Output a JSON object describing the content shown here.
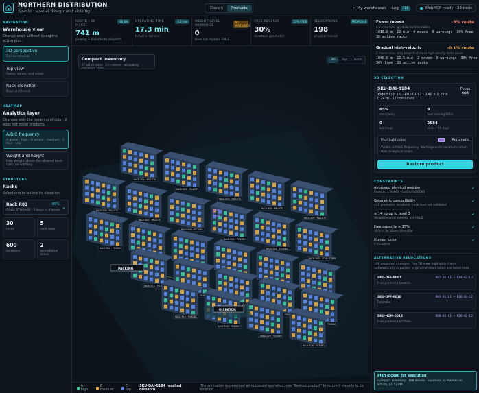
{
  "header": {
    "title": "NORTHERN DISTRIBUTION",
    "subtitle": "Spacio · spatial design and slotting",
    "modes": [
      "Design",
      "Products"
    ],
    "active_mode": "Products",
    "my_warehouses": "← My warehouses",
    "log_label": "Log",
    "log_count": "186",
    "webmcp": "WebMCP ready · 33 tools"
  },
  "left": {
    "nav_label": "NAVIGATION",
    "view_title": "Warehouse view",
    "view_desc": "Change scale without losing the active plan.",
    "views": [
      {
        "title": "3D perspective",
        "sub": "Full warehouse",
        "active": true
      },
      {
        "title": "Top view",
        "sub": "Racks, zones, and aisles",
        "active": false
      },
      {
        "title": "Rack elevation",
        "sub": "Bays and levels",
        "active": false
      }
    ],
    "heatmap_label": "HEATMAP",
    "heatmap_title": "Analytics layer",
    "heatmap_desc": "Changes only the meaning of color; it does not move products.",
    "layers": [
      {
        "title": "A/B/C frequency",
        "sub": "A green · high · B amber · medium · C blue · low",
        "active": true
      },
      {
        "title": "Weight and height",
        "sub": "Red: weight above the allowed level · dark: no warning",
        "active": false
      }
    ],
    "structure_label": "STRUCTURE",
    "structure_title": "Racks",
    "structure_desc": "Select one to isolate its elevation.",
    "rack": {
      "name": "Rack R03",
      "pct": "85%",
      "meta": "COLD STORAGE · 5 bays × 4 levels"
    },
    "stats": [
      {
        "value": "30",
        "label": "racks"
      },
      {
        "value": "5",
        "label": "rack rows"
      },
      {
        "value": "600",
        "label": "locations"
      },
      {
        "value": "2",
        "label": "operational zones"
      }
    ]
  },
  "kpis": [
    {
      "label": "ROUTE / 20 PICKS",
      "badge": "-16.6%",
      "value": "741 m",
      "sub": "picking + transfer to dispatch",
      "warn": false
    },
    {
      "label": "OPERATING TIME",
      "badge": "-3.2 min",
      "value": "17.3 min",
      "sub": "travel + service",
      "warn": false
    },
    {
      "label": "WEIGHT/LEVEL WARNINGS",
      "badge": "NO WARNINGS",
      "value": "0",
      "sub": "does not replace RNLE",
      "warn": true
    },
    {
      "label": "FREE RESERVE",
      "badge": "15% FREE",
      "value": "30%",
      "sub": "locations geometric",
      "warn": false
    },
    {
      "label": "RELOCATIONS",
      "badge": "PROPOSAL",
      "value": "198",
      "sub": "physical moves",
      "warn": false
    }
  ],
  "canvas": {
    "view_title": "Compact inventory",
    "view_sub": "27 active racks · 3 in reserve · occupancy maximum 100%",
    "view_buttons": [
      "3D",
      "Top",
      "Rack"
    ],
    "active_view_button": "3D",
    "floor_labels": [
      "PACKING",
      "DISPATCH"
    ],
    "rack_tags": [
      "RACK 801 · PALLETS",
      "RACK 802 · PALLETS",
      "RACK 803 · PALLETS",
      "RACK 804 · PALLETS",
      "RACK 805 · PALLETS",
      "RACK 806 · PALLETS",
      "RACK 807 · PALLETS",
      "RACK 808 · PICKING",
      "RACK R01 · PICKING",
      "RACK R02 · PICKING",
      "RACK R03 · COLD STORE",
      "RACK R04 · PICKING",
      "RACK R05 · PICKING",
      "RACK R06 · PICKING",
      "RACK R09 · PICKING",
      "RACK R10 · PICKING",
      "RACK R11 · PICKING",
      "RACK R12 · PICKING",
      "RACK R13 · PICKING",
      "RACK R14 · PICKING",
      "RACK R15 · PICKING",
      "RACK R16 · PICKING",
      "RACK R18 · PICKING",
      "RACK R20 · PICKING",
      "RACK R24 · PICKING",
      "RACK R26 · PICKING"
    ],
    "legend": [
      {
        "label": "A · high",
        "color": "#37d3a0"
      },
      {
        "label": "B · medium",
        "color": "#f2b13d"
      },
      {
        "label": "C · low",
        "color": "#5b8cf0"
      }
    ],
    "dispatch_msg": "SKU-DAI-0184 reached dispatch.",
    "legend_note": "The animation represented an outbound operation; use \"Restore product\" to return it visually to its location."
  },
  "right": {
    "scenarios": [
      {
        "title": "Fewer moves",
        "pct": "-3% route",
        "desc": "4 moves max · gradual implementation",
        "stats": "1018.8 m  22 min  4 moves  0 warnings  30% free\n30 active racks"
      },
      {
        "title": "Gradual high-velocity",
        "pct": "-0.1% route",
        "desc": "2 moves max · only keeps that move high-velocity items closer",
        "stats": "1048.8 m  22.5 min  2 moves  0 warnings  30% free\n30% free  30 active racks"
      }
    ],
    "selection_label": "3D SELECTION",
    "selection": {
      "sku": "SKU-DAI-0184",
      "desc": "Yogurt Cup 1l9 · R03-01-L2 · 0.40 × 0.29 × 0.24 m · 11 containers",
      "focus": "Focus rack",
      "cells": [
        {
          "value": "85%",
          "label": "occupancy"
        },
        {
          "value": "9",
          "label": "fast-moving SKUs"
        },
        {
          "value": "0",
          "label": "warnings"
        },
        {
          "value": "2684",
          "label": "picks / 90 days"
        }
      ],
      "highlight_label": "Highlight color",
      "highlight_mode": "Automatic",
      "highlight_color": "#8c6bd6",
      "highlight_desc": "Visible in A/B/C frequency. Warnings and relocations retain their analytical colors.",
      "restore": "Restore product"
    },
    "constraints_label": "CONSTRAINTS",
    "constraints": [
      {
        "title": "Approved physical revision",
        "sub": "Revision 1 linked · facility-6df6f3f3"
      },
      {
        "title": "Geometric compatibility",
        "sub": "421 geometric locations · rack load not validated"
      },
      {
        "title": "≤ 14 kg up to level 3",
        "sub": "Weight/level screening, not RNLE"
      },
      {
        "title": "Free capacity ≥ 15%",
        "sub": "30% of locations available"
      },
      {
        "title": "Human locks",
        "sub": "0 locations"
      }
    ],
    "alt_label": "ALTERNATIVE RELOCATIONS",
    "alt_desc": "198 proposed changes. The 3D view highlights them automatically in purple; origin and destination are listed here.",
    "relocations": [
      {
        "sku": "SKU-OFF-0007",
        "path": "R07-01-L1 → R14-02-L2",
        "sub": "Free preferred location"
      },
      {
        "sku": "SKU-OFF-0010",
        "path": "R03-01-L1 → R16-02-L2",
        "sub": "Relocate"
      },
      {
        "sku": "SKU-HOM-0013",
        "path": "R08-01-L1 → R26-02-L2",
        "sub": "Free preferred location"
      }
    ],
    "plan_lock_title": "Plan locked for execution",
    "plan_lock_desc": "Compact inventory · 198 moves · approved by Human on 9/5/26, 11:53 PM"
  }
}
